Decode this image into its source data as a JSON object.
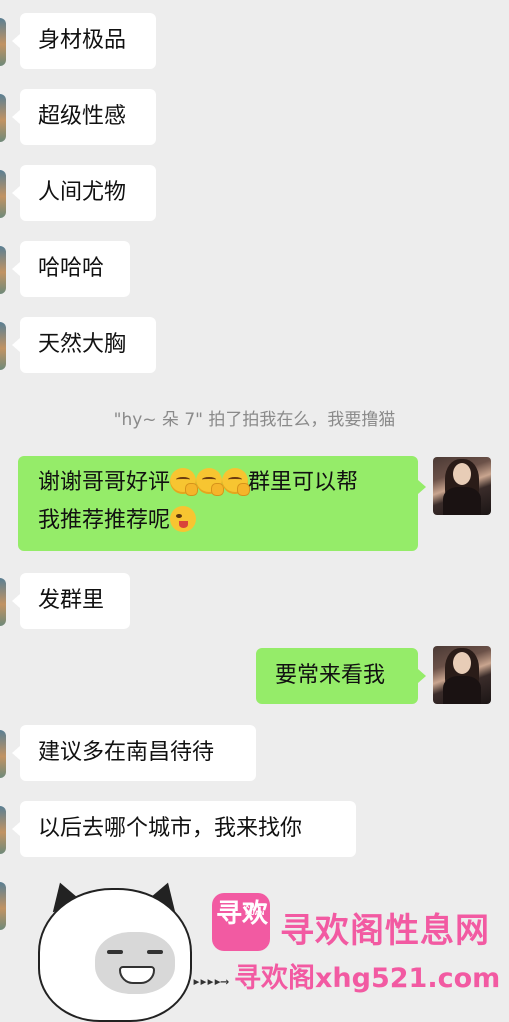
{
  "chat": {
    "messages": [
      {
        "side": "left",
        "text": "身材极品"
      },
      {
        "side": "left",
        "text": "超级性感"
      },
      {
        "side": "left",
        "text": "人间尤物"
      },
      {
        "side": "left",
        "text": "哈哈哈"
      },
      {
        "side": "left",
        "text": "天然大胸"
      },
      {
        "side": "right",
        "line1": "谢谢哥哥好评",
        "line1_tail": "群里可以帮",
        "line2": "我推荐推荐呢"
      },
      {
        "side": "left",
        "text": "发群里"
      },
      {
        "side": "right",
        "text": "要常来看我"
      },
      {
        "side": "left",
        "text": "建议多在南昌待待"
      },
      {
        "side": "left",
        "text": "以后去哪个城市，我来找你"
      }
    ],
    "system_note": "\"hy~ 朵 7\" 拍了拍我在么，我要撸猫"
  },
  "watermark": {
    "logo_big": "寻欢",
    "logo_small": "XUN HUAN",
    "title": "寻欢阁性息网",
    "url": "寻欢阁xhg521.com",
    "arrows": "▸▸▸▸→"
  },
  "icons": {
    "emoji_1": "thinking-face-icon",
    "emoji_2": "winking-tongue-face-icon",
    "sticker": "cat-face-sticker"
  },
  "colors": {
    "background": "#ededed",
    "bubble_left": "#ffffff",
    "bubble_right": "#95ec69",
    "watermark": "#f25aa2"
  }
}
